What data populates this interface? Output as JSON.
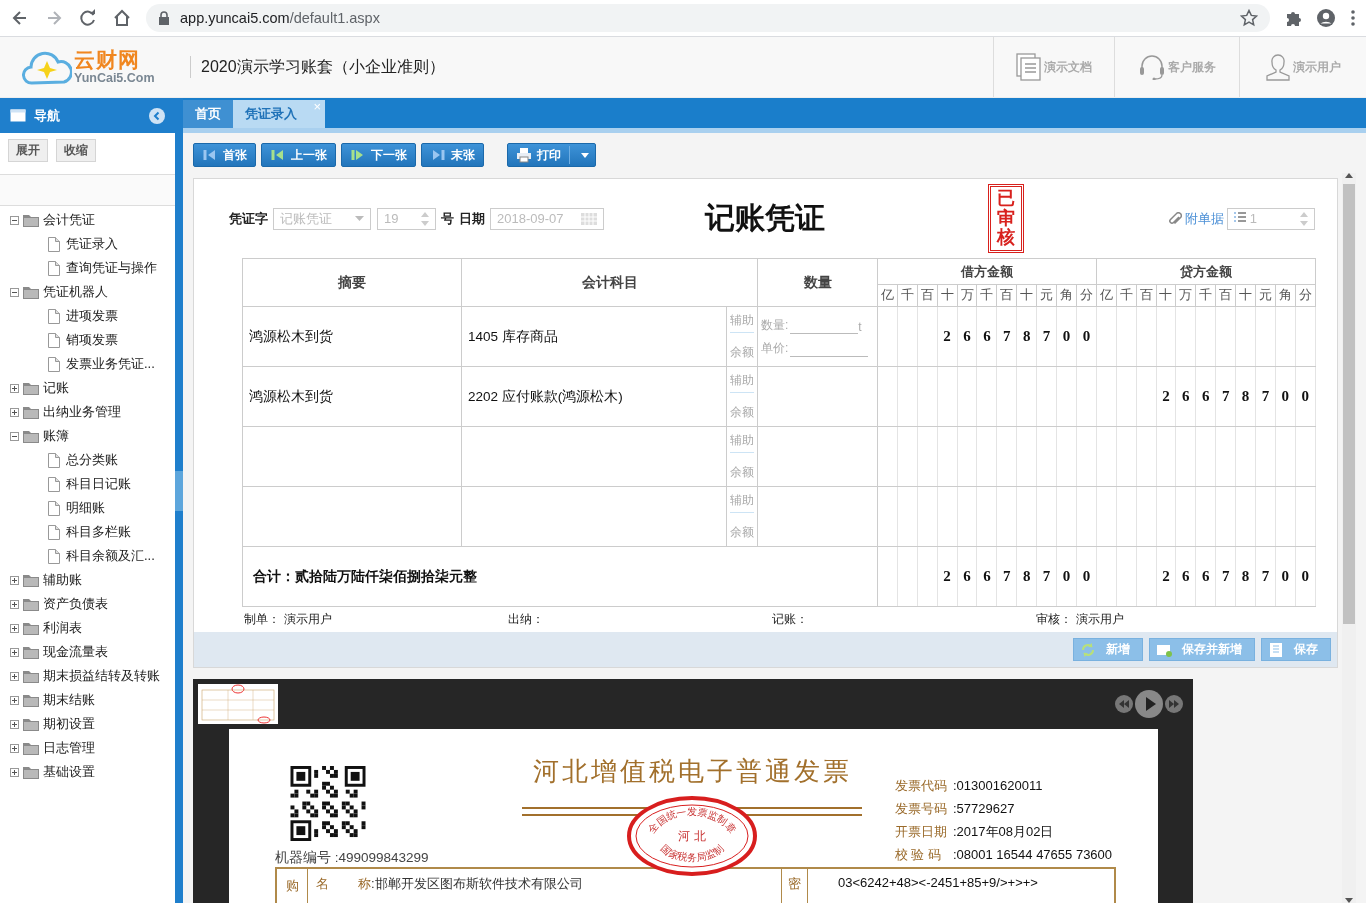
{
  "browser": {
    "url_host": "app.yuncai5.com",
    "url_path": "/default1.aspx"
  },
  "header": {
    "logo_name": "云财网",
    "logo_domain": "YunCai5.Com",
    "account_title": "2020演示学习账套（小企业准则）",
    "links": [
      {
        "label": "演示文档"
      },
      {
        "label": "客户服务"
      },
      {
        "label": "演示用户"
      }
    ]
  },
  "sidebar": {
    "title": "导航",
    "buttons": [
      "展开",
      "收缩"
    ],
    "tree": [
      {
        "label": "会计凭证",
        "expanded": true,
        "children": [
          {
            "label": "凭证录入"
          },
          {
            "label": "查询凭证与操作"
          }
        ]
      },
      {
        "label": "凭证机器人",
        "expanded": true,
        "children": [
          {
            "label": "进项发票"
          },
          {
            "label": "销项发票"
          },
          {
            "label": "发票业务凭证..."
          }
        ]
      },
      {
        "label": "记账",
        "expanded": false
      },
      {
        "label": "出纳业务管理",
        "expanded": false
      },
      {
        "label": "账簿",
        "expanded": true,
        "children": [
          {
            "label": "总分类账"
          },
          {
            "label": "科目日记账"
          },
          {
            "label": "明细账"
          },
          {
            "label": "科目多栏账"
          },
          {
            "label": "科目余额及汇..."
          }
        ]
      },
      {
        "label": "辅助账",
        "expanded": false
      },
      {
        "label": "资产负债表",
        "expanded": false
      },
      {
        "label": "利润表",
        "expanded": false
      },
      {
        "label": "现金流量表",
        "expanded": false
      },
      {
        "label": "期末损益结转及转账",
        "expanded": false
      },
      {
        "label": "期末结账",
        "expanded": false
      },
      {
        "label": "期初设置",
        "expanded": false
      },
      {
        "label": "日志管理",
        "expanded": false
      },
      {
        "label": "基础设置",
        "expanded": false
      }
    ]
  },
  "tabs": [
    {
      "label": "首页",
      "selected": false
    },
    {
      "label": "凭证录入",
      "selected": true,
      "close": "×"
    }
  ],
  "toolbar": {
    "buttons": [
      {
        "label": "首张"
      },
      {
        "label": "上一张"
      },
      {
        "label": "下一张"
      },
      {
        "label": "末张"
      }
    ],
    "print": "打印"
  },
  "voucher": {
    "type_label": "凭证字",
    "type_value": "记账凭证",
    "number": "19",
    "number_label": "号",
    "date_label": "日期",
    "date": "2018-09-07",
    "title": "记账凭证",
    "stamp": "已审核",
    "attach_label": "附单据",
    "attach_count": "1",
    "columns": {
      "summary": "摘要",
      "account": "会计科目",
      "quantity": "数量",
      "debit": "借方金额",
      "credit": "贷方金额",
      "debit_units": [
        "亿",
        "千",
        "百",
        "十",
        "万",
        "千",
        "百",
        "十",
        "元",
        "角",
        "分"
      ],
      "credit_units": [
        "亿",
        "千",
        "百",
        "十",
        "万",
        "千",
        "百",
        "十",
        "元",
        "角",
        "分"
      ]
    },
    "rows": [
      {
        "summary": "鸿源松木到货",
        "account": "1405 库存商品",
        "aux": "辅助",
        "balance": "余额",
        "quantity_label": "数量:",
        "unit": "t",
        "price_label": "单价:",
        "debit": [
          "2",
          "6",
          "6",
          "7",
          "8",
          "7",
          "0",
          "0"
        ]
      },
      {
        "summary": "鸿源松木到货",
        "account": "2202 应付账款(鸿源松木)",
        "aux": "辅助",
        "balance": "余额",
        "credit": [
          "2",
          "6",
          "6",
          "7",
          "8",
          "7",
          "0",
          "0"
        ]
      },
      {
        "aux": "辅助",
        "balance": "余额"
      },
      {
        "aux": "辅助",
        "balance": "余额"
      }
    ],
    "total": {
      "label": "合计：贰拾陆万陆仟柒佰捌拾柒元整",
      "debit": [
        "2",
        "6",
        "6",
        "7",
        "8",
        "7",
        "0",
        "0"
      ],
      "credit": [
        "2",
        "6",
        "6",
        "7",
        "8",
        "7",
        "0",
        "0"
      ]
    },
    "signatures": [
      {
        "label": "制单：",
        "name": "演示用户"
      },
      {
        "label": "出纳："
      },
      {
        "label": "记账："
      },
      {
        "label": "审核：",
        "name": "演示用户"
      }
    ]
  },
  "actions": [
    {
      "label": "新增"
    },
    {
      "label": "保存并新增"
    },
    {
      "label": "保存"
    }
  ],
  "viewer": {
    "invoice": {
      "title": "河北增值税电子普通发票",
      "machine_label": "机器编号",
      "machine_value": ":499099843299",
      "seal": {
        "top": "全国统一发票监制章",
        "middle": "河 北",
        "bottom": "国家税务局监制"
      },
      "fields": [
        {
          "label": "发票代码",
          "value": ":013001620011"
        },
        {
          "label": "发票号码",
          "value": ":57729627"
        },
        {
          "label": "开票日期",
          "value": ":2017年08月02日"
        },
        {
          "label": "校 验 码",
          "value": ":08001 16544 47655 73600"
        }
      ],
      "buyer_side": "购",
      "buyer_name_label": "名        称",
      "buyer_name": ":邯郸开发区图布斯软件技术有限公司",
      "cipher_side": "密",
      "cipher": "03<6242+48><-2451+85+9/>+>+>"
    }
  }
}
